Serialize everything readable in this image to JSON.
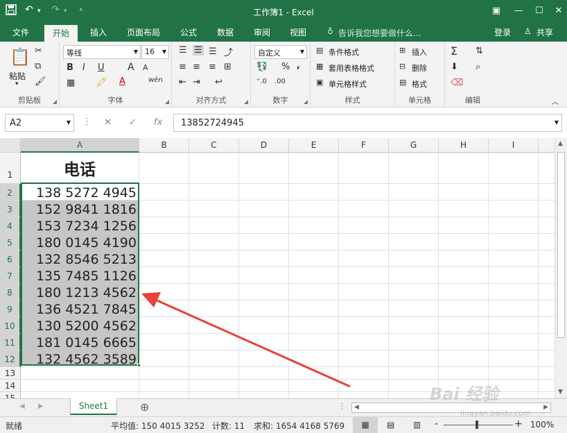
{
  "window": {
    "title": "工作簿1 - Excel",
    "qat": {
      "save_icon": "save-icon",
      "undo_icon": "undo-icon",
      "redo_icon": "redo-icon",
      "customize_icon": "customize-qat-icon"
    }
  },
  "tabs": {
    "items": [
      "文件",
      "开始",
      "插入",
      "页面布局",
      "公式",
      "数据",
      "审阅",
      "视图"
    ],
    "active": "开始",
    "tell_me": "告诉我您想要做什么...",
    "login": "登录",
    "share": "共享"
  },
  "ribbon": {
    "clipboard": {
      "paste": "粘贴",
      "label": "剪贴板"
    },
    "font": {
      "name": "等线",
      "size": "16",
      "label": "字体",
      "bold": "B",
      "italic": "I",
      "underline": "U",
      "grow": "A",
      "shrink": "A",
      "phonetic": "wén"
    },
    "alignment": {
      "label": "对齐方式"
    },
    "number": {
      "format": "自定义",
      "label": "数字",
      "percent": "%",
      "comma": ","
    },
    "styles": {
      "conditional": "条件格式",
      "table": "套用表格格式",
      "cell": "单元格样式",
      "label": "样式"
    },
    "cells": {
      "insert": "插入",
      "delete": "删除",
      "format": "格式",
      "label": "单元格"
    },
    "editing": {
      "label": "编辑"
    }
  },
  "formula_bar": {
    "name_box": "A2",
    "fx": "fx",
    "value": "13852724945"
  },
  "grid": {
    "columns": [
      "A",
      "B",
      "C",
      "D",
      "E",
      "F",
      "G",
      "H",
      "I"
    ],
    "rows": [
      "1",
      "2",
      "3",
      "4",
      "5",
      "6",
      "7",
      "8",
      "9",
      "10",
      "11",
      "12",
      "13",
      "14",
      "15"
    ],
    "header": "电话",
    "values": [
      "138 5272 4945",
      "152 9841 1816",
      "153 7234 1256",
      "180 0145 4190",
      "132 8546 5213",
      "135 7485 1126",
      "180 1213 4562",
      "136 4521 7845",
      "130 5200 4562",
      "181 0145 6665",
      "132 4562 3589"
    ]
  },
  "sheets": {
    "active": "Sheet1"
  },
  "status": {
    "mode": "就绪",
    "average": "平均值: 150 4015 3252",
    "count": "计数: 11",
    "sum": "求和: 1654 4168 5769",
    "zoom": "100%",
    "zoom_minus": "-",
    "zoom_plus": "+"
  },
  "colors": {
    "accent": "#217346",
    "annotation_arrow": "#e8413a"
  },
  "watermark": {
    "text": "Bai 经验",
    "sub": "jingyan.baidu.com"
  }
}
